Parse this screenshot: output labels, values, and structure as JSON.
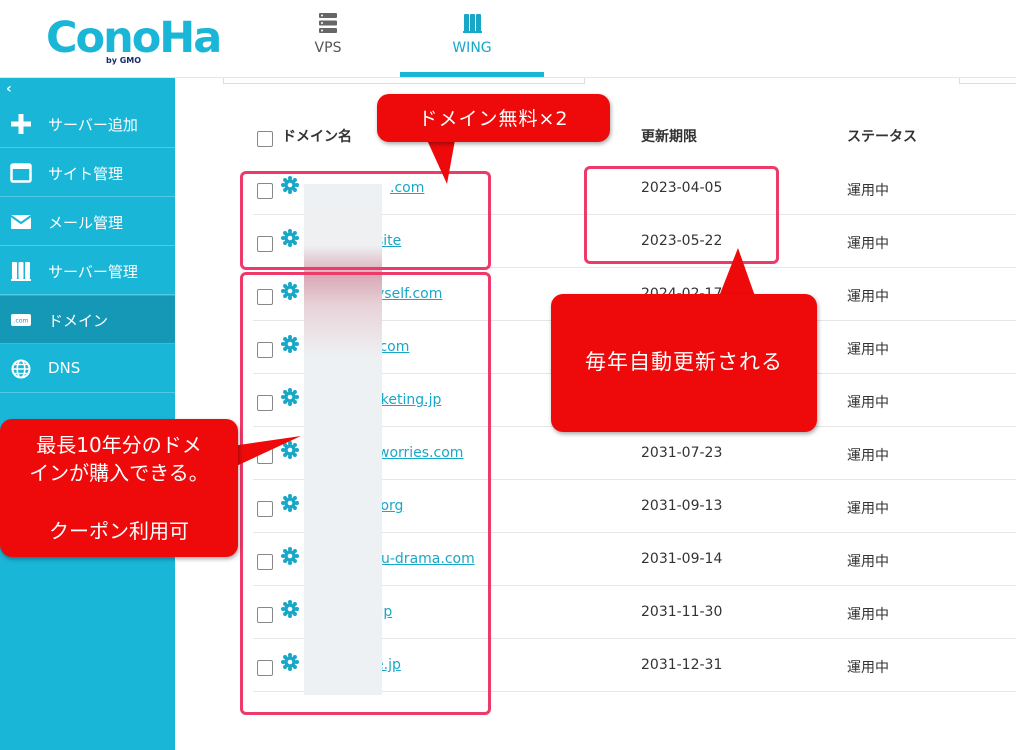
{
  "header": {
    "logo_text": "ConoHa",
    "logo_sub": "by GMO",
    "nav": [
      {
        "label": "VPS"
      },
      {
        "label": "WING"
      }
    ]
  },
  "sidebar": {
    "collapse_glyph": "‹",
    "items": [
      {
        "label": "サーバー追加",
        "icon": "plus-icon"
      },
      {
        "label": "サイト管理",
        "icon": "window-icon"
      },
      {
        "label": "メール管理",
        "icon": "envelope-icon"
      },
      {
        "label": "サーバー管理",
        "icon": "server-icon"
      },
      {
        "label": "ドメイン",
        "icon": "dotcom-icon",
        "active": true
      },
      {
        "label": "DNS",
        "icon": "globe-icon"
      }
    ]
  },
  "table": {
    "headers": {
      "domain": "ドメイン名",
      "expiry": "更新期限",
      "status": "ステータス"
    },
    "rows": [
      {
        "domain": ".com",
        "expiry": "2023-04-05",
        "status": "運用中"
      },
      {
        "domain": "site",
        "expiry": "2023-05-22",
        "status": "運用中"
      },
      {
        "domain": "yself.com",
        "expiry": "2024-02-17",
        "status": "運用中"
      },
      {
        "domain": ".com",
        "expiry": "",
        "status": "運用中"
      },
      {
        "domain": "rketing.jp",
        "expiry": "",
        "status": "運用中"
      },
      {
        "domain": "worries.com",
        "expiry": "2031-07-23",
        "status": "運用中"
      },
      {
        "domain": ".org",
        "expiry": "2031-09-13",
        "status": "運用中"
      },
      {
        "domain": "u-drama.com",
        "expiry": "2031-09-14",
        "status": "運用中"
      },
      {
        "domain": ".jp",
        "expiry": "2031-11-30",
        "status": "運用中"
      },
      {
        "domain": "e.jp",
        "expiry": "2031-12-31",
        "status": "運用中"
      }
    ]
  },
  "annotations": {
    "free_domains": "ドメイン無料×2",
    "auto_renew": "毎年自動更新される",
    "max_years_line1": "最長10年分のドメ",
    "max_years_line2": "インが購入できる。",
    "coupon": "クーポン利用可"
  },
  "colors": {
    "brand": "#19b6d8",
    "sidebar_active": "#1598b6",
    "link": "#19a7c8",
    "callout_red": "#ee0a0a",
    "highlight_pink": "#ee3a6a"
  }
}
